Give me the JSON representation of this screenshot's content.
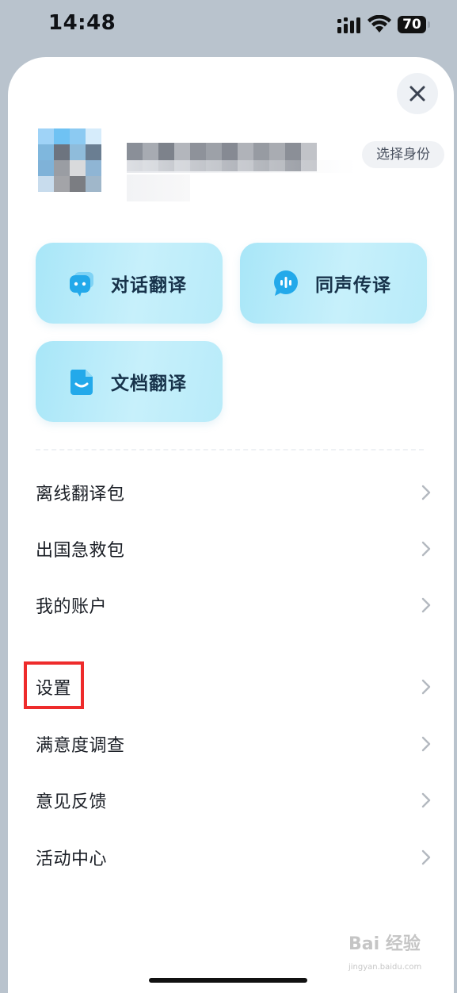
{
  "status_bar": {
    "time": "14:48",
    "battery": "70",
    "icons": [
      "signal-icon",
      "wifi-icon",
      "battery-icon"
    ]
  },
  "header": {
    "close_icon": "close-icon",
    "identity_button": "选择身份"
  },
  "feature_cards": [
    {
      "label": "对话翻译",
      "icon": "chat-bubble-icon"
    },
    {
      "label": "同声传译",
      "icon": "voice-wave-icon"
    },
    {
      "label": "文档翻译",
      "icon": "document-icon"
    }
  ],
  "menu": {
    "items": [
      {
        "label": "离线翻译包"
      },
      {
        "label": "出国急救包"
      },
      {
        "label": "我的账户"
      },
      {
        "label": "设置"
      },
      {
        "label": "满意度调查"
      },
      {
        "label": "意见反馈"
      },
      {
        "label": "活动中心"
      }
    ]
  },
  "colors": {
    "card_accent": "#a8e6f8",
    "icon_blue": "#2bb0ec",
    "highlight": "#ee2b2b"
  },
  "watermark": {
    "text": "Bai 经验",
    "url": "jingyan.baidu.com"
  }
}
